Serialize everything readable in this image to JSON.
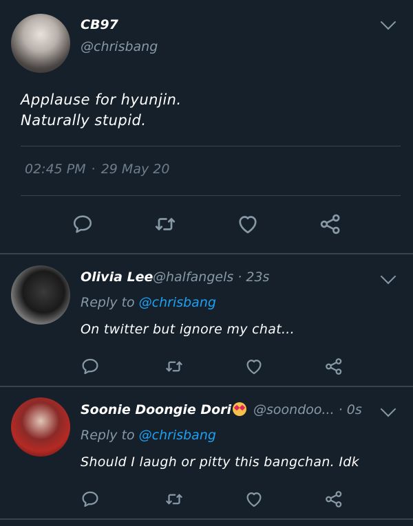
{
  "main_tweet": {
    "display_name": "CB97",
    "handle": "@chrisbang",
    "text_line1": "Applause for hyunjin.",
    "text_line2": "Naturally stupid.",
    "time": "02:45 PM",
    "separator": "·",
    "date": "29 May 20"
  },
  "replies": [
    {
      "display_name": "Olivia Lee",
      "handle_time": "@halfangels · 23s",
      "reply_prefix": "Reply to",
      "mention": "@chrisbang",
      "text": "On twitter but ignore my chat..."
    },
    {
      "display_name": "Soonie Doongie Dori",
      "handle_time": "@soondoo... · 0s",
      "reply_prefix": "Reply to",
      "mention": "@chrisbang",
      "text": "Should I laugh or pitty this bangchan. Idk"
    }
  ],
  "icons": {
    "reply": "reply-icon",
    "retweet": "retweet-icon",
    "like": "heart-icon",
    "share": "share-icon",
    "more": "chevron-down-icon"
  },
  "colors": {
    "background": "#15202b",
    "secondary_text": "#8899a6",
    "link": "#1da1f2",
    "divider": "#38444d"
  }
}
